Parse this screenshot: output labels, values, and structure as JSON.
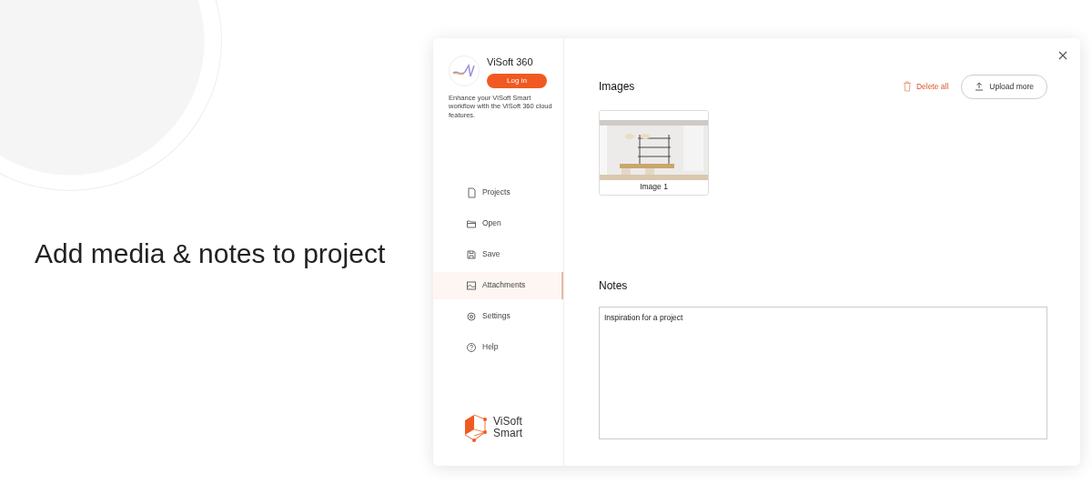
{
  "headline": "Add media & notes to project",
  "account": {
    "title": "ViSoft 360",
    "login_button": "Log in",
    "description": "Enhance your ViSoft Smart workflow with the ViSoft 360 cloud features."
  },
  "sidebar": {
    "items": [
      {
        "kind": "projects",
        "label": "Projects",
        "selected": false
      },
      {
        "kind": "open",
        "label": "Open",
        "selected": false
      },
      {
        "kind": "save",
        "label": "Save",
        "selected": false
      },
      {
        "kind": "attachments",
        "label": "Attachments",
        "selected": true
      },
      {
        "kind": "settings",
        "label": "Settings",
        "selected": false
      },
      {
        "kind": "help",
        "label": "Help",
        "selected": false
      }
    ],
    "logo": [
      "ViSoft",
      "Smart"
    ]
  },
  "images": {
    "title": "Images",
    "delete_button": "Delete all",
    "upload_button": "Upload more",
    "items": [
      {
        "kind": "picture",
        "caption": "Image 1"
      }
    ]
  },
  "notes": {
    "title": "Notes",
    "value": "Inspiration for a project"
  }
}
